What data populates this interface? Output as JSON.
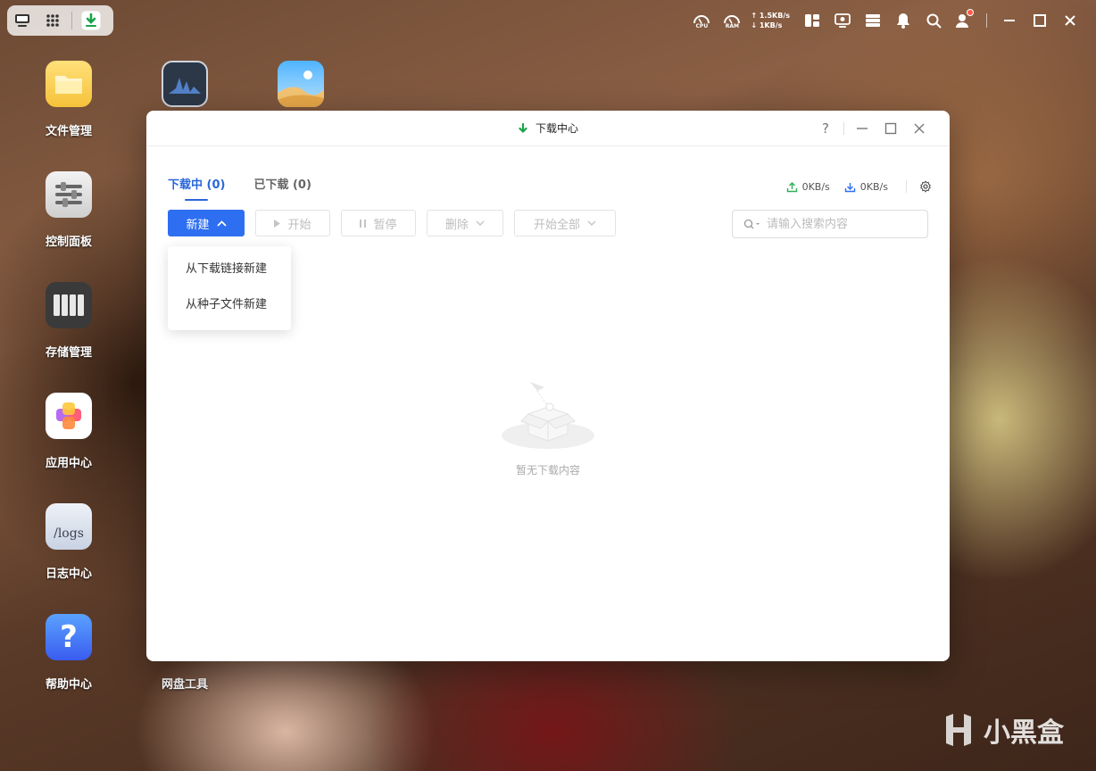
{
  "topbar": {
    "left_icons": [
      "monitor-icon",
      "apps-grid-icon",
      "download-app-icon"
    ],
    "gauges": [
      {
        "label": "CPU",
        "icon": "cpu-gauge-icon"
      },
      {
        "label": "RAM",
        "icon": "ram-gauge-icon"
      }
    ],
    "upload_speed": "↑ 1.5KB/s",
    "download_speed": "↓ 1KB/s",
    "right_icons": [
      "widget-panel-icon",
      "remote-monitor-icon",
      "server-status-icon",
      "bell-icon",
      "search-icon",
      "user-icon",
      "minimize-icon",
      "maximize-icon",
      "close-icon"
    ],
    "notification_color": "#ff5a4a"
  },
  "desktop": {
    "icons": [
      {
        "label": "文件管理",
        "icon": "folder-icon"
      },
      {
        "label": "控制面板",
        "icon": "sliders-icon"
      },
      {
        "label": "存储管理",
        "icon": "storage-icon"
      },
      {
        "label": "应用中心",
        "icon": "app-center-icon"
      },
      {
        "label": "日志中心",
        "icon": "logs-icon",
        "image_text": "/logs"
      },
      {
        "label": "帮助中心",
        "icon": "help-icon",
        "image_text": "?"
      },
      {
        "label": "网盘工具",
        "icon": "netdisk-icon"
      }
    ],
    "top_row_icons": [
      "resource-monitor-icon",
      "photos-icon"
    ]
  },
  "window": {
    "title": "下载中心",
    "help": "?",
    "tabs": [
      {
        "label": "下载中 (0)",
        "active": true
      },
      {
        "label": "已下载 (0)",
        "active": false
      }
    ],
    "upload_speed": "0KB/s",
    "download_speed": "0KB/s",
    "toolbar": {
      "new": "新建",
      "start": "开始",
      "pause": "暂停",
      "delete": "删除",
      "start_all": "开始全部"
    },
    "search_placeholder": "请输入搜索内容",
    "new_menu": [
      "从下载链接新建",
      "从种子文件新建"
    ],
    "empty_text": "暂无下载内容",
    "accent_color": "#2e6ff2"
  },
  "watermark": "小黑盒"
}
